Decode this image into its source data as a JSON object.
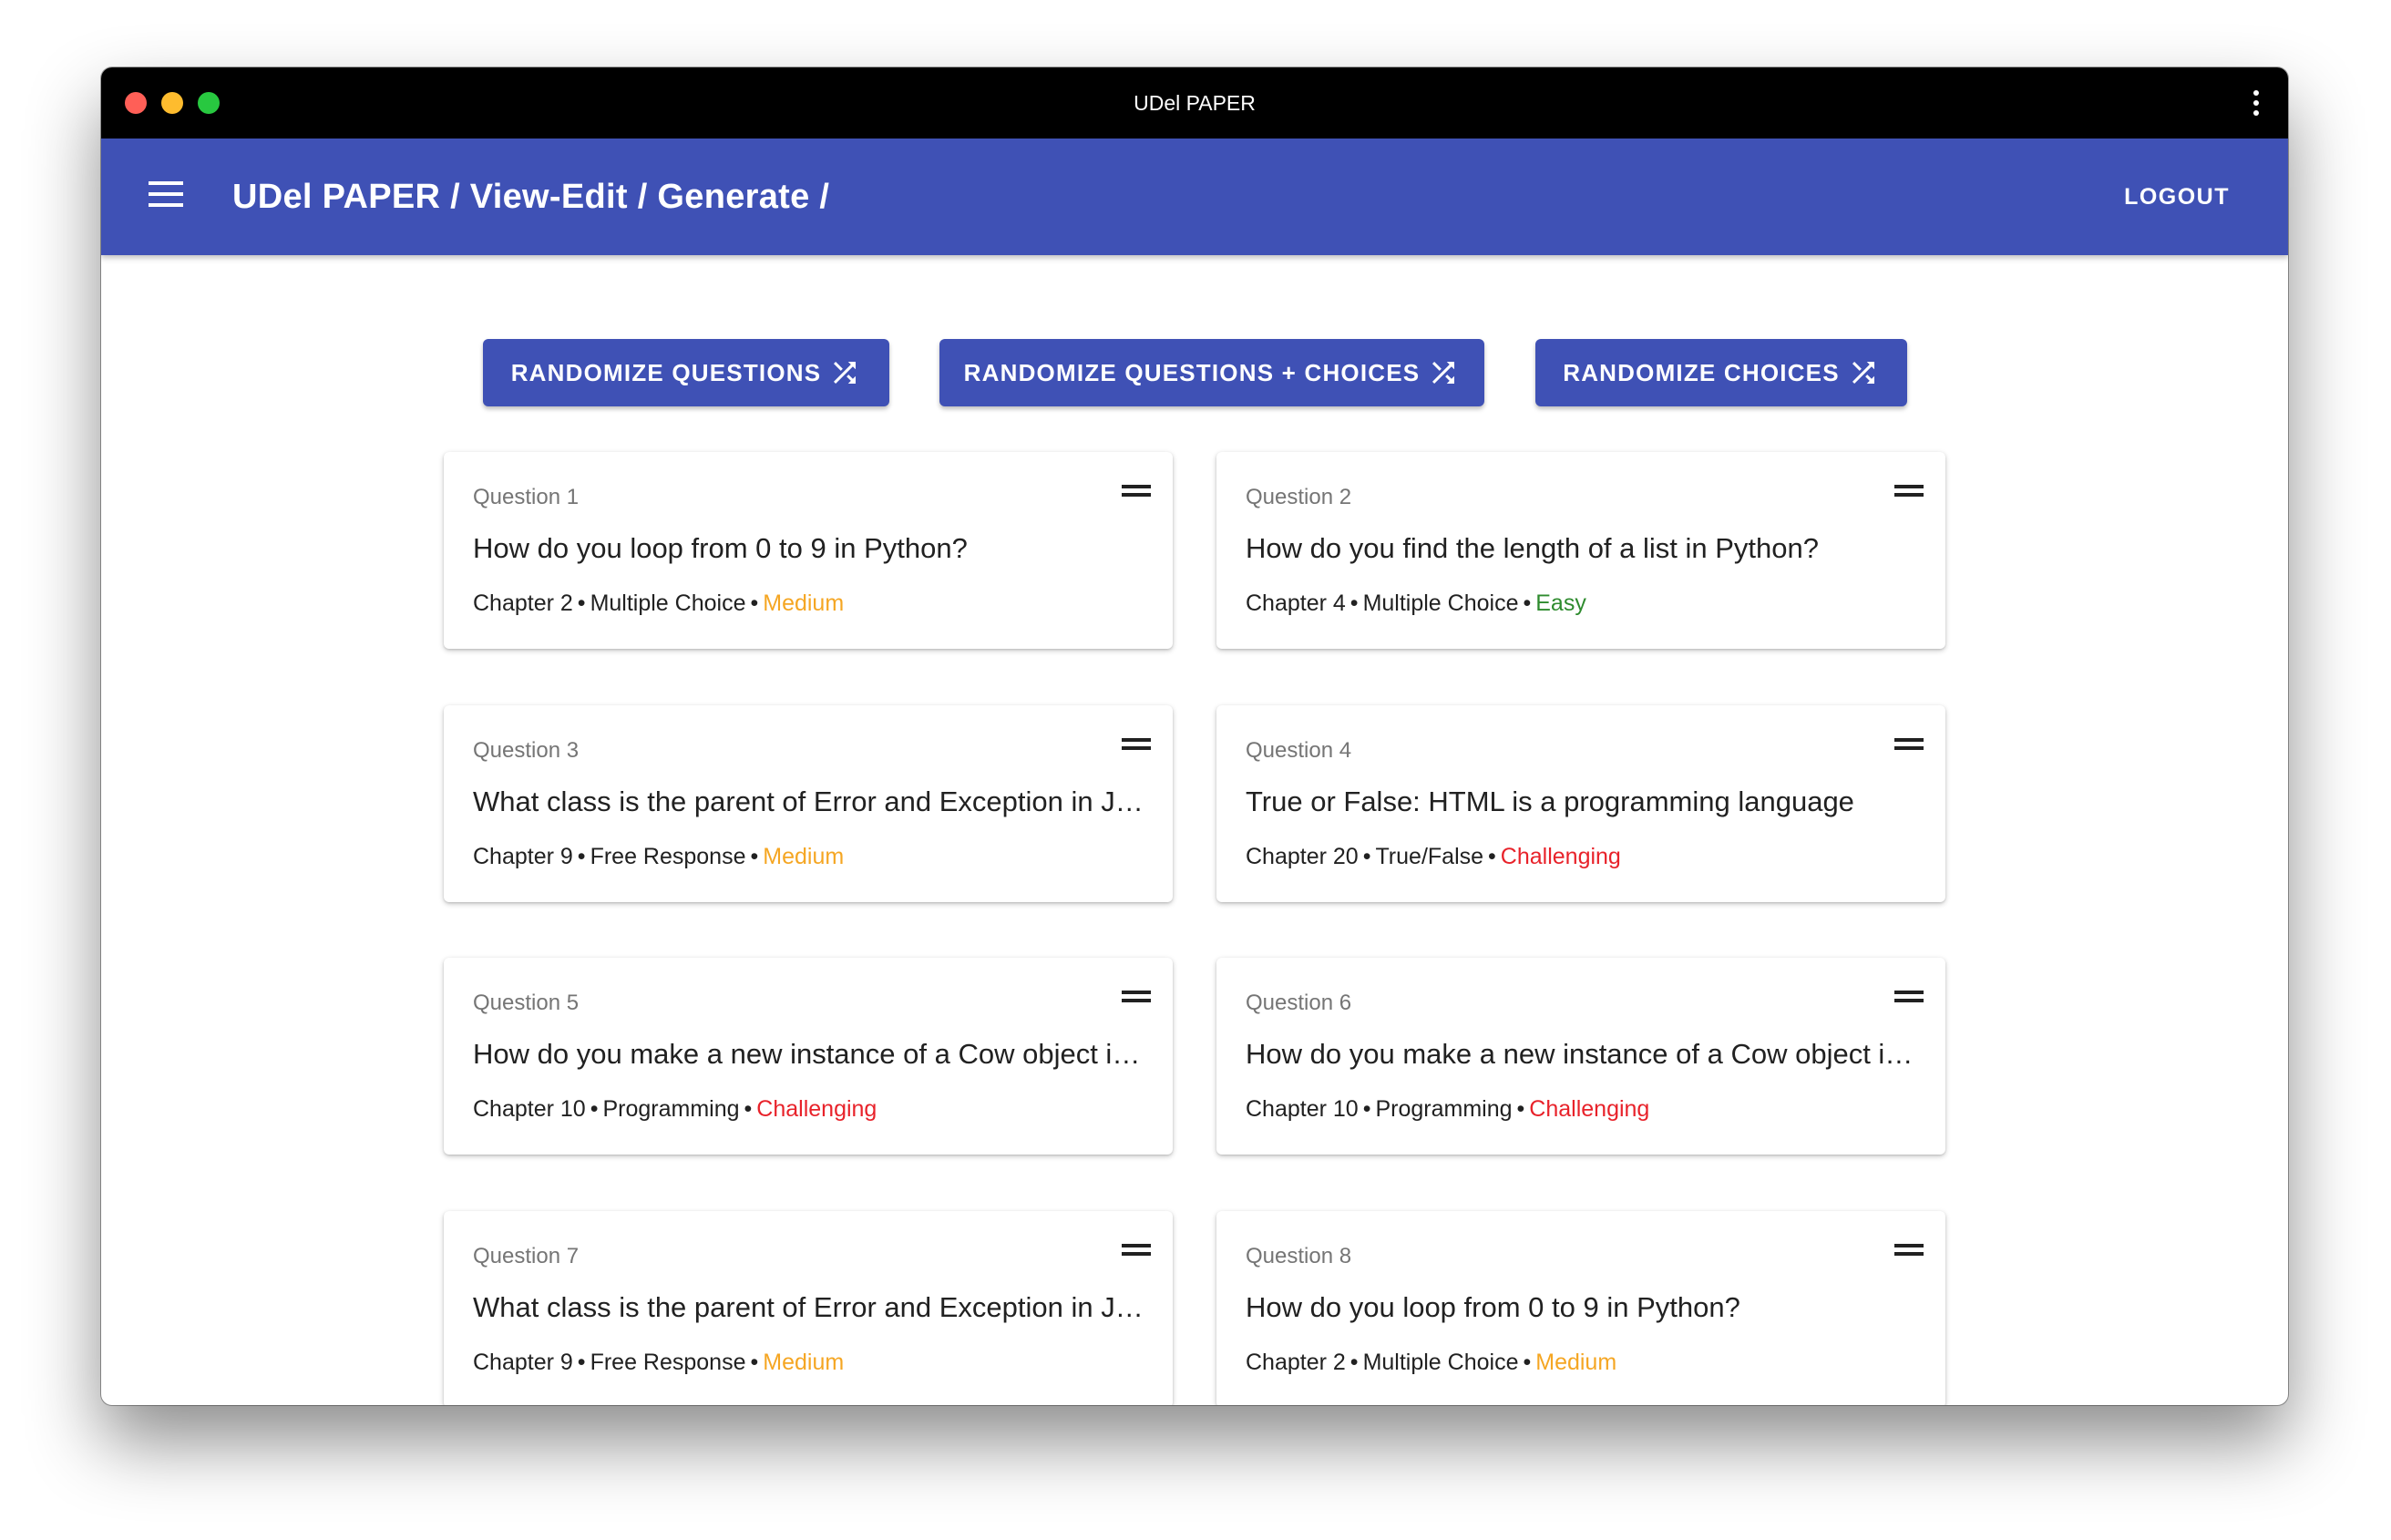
{
  "window": {
    "title": "UDel PAPER"
  },
  "appbar": {
    "breadcrumb": "UDel PAPER / View-Edit / Generate /",
    "logout_label": "LOGOUT"
  },
  "actions": {
    "randomize_questions": "RANDOMIZE QUESTIONS",
    "randomize_questions_choices": "RANDOMIZE QUESTIONS + CHOICES",
    "randomize_choices": "RANDOMIZE CHOICES",
    "icon": "shuffle-icon"
  },
  "colors": {
    "primary": "#3f51b5",
    "medium": "#f5a623",
    "easy": "#2e8b2e",
    "challenging": "#e8222a"
  },
  "questions": [
    {
      "label": "Question 1",
      "text": "How do you loop from 0 to 9 in Python?",
      "chapter": "Chapter 2",
      "type": "Multiple Choice",
      "difficulty": "Medium"
    },
    {
      "label": "Question 2",
      "text": "How do you find the length of a list in Python?",
      "chapter": "Chapter 4",
      "type": "Multiple Choice",
      "difficulty": "Easy"
    },
    {
      "label": "Question 3",
      "text": "What class is the parent of Error and Exception in Java?",
      "chapter": "Chapter 9",
      "type": "Free Response",
      "difficulty": "Medium"
    },
    {
      "label": "Question 4",
      "text": "True or False: HTML is a programming language",
      "chapter": "Chapter 20",
      "type": "True/False",
      "difficulty": "Challenging"
    },
    {
      "label": "Question 5",
      "text": "How do you make a new instance of a Cow object in Java?",
      "chapter": "Chapter 10",
      "type": "Programming",
      "difficulty": "Challenging"
    },
    {
      "label": "Question 6",
      "text": "How do you make a new instance of a Cow object in Java?",
      "chapter": "Chapter 10",
      "type": "Programming",
      "difficulty": "Challenging"
    },
    {
      "label": "Question 7",
      "text": "What class is the parent of Error and Exception in Java?",
      "chapter": "Chapter 9",
      "type": "Free Response",
      "difficulty": "Medium"
    },
    {
      "label": "Question 8",
      "text": "How do you loop from 0 to 9 in Python?",
      "chapter": "Chapter 2",
      "type": "Multiple Choice",
      "difficulty": "Medium"
    }
  ]
}
